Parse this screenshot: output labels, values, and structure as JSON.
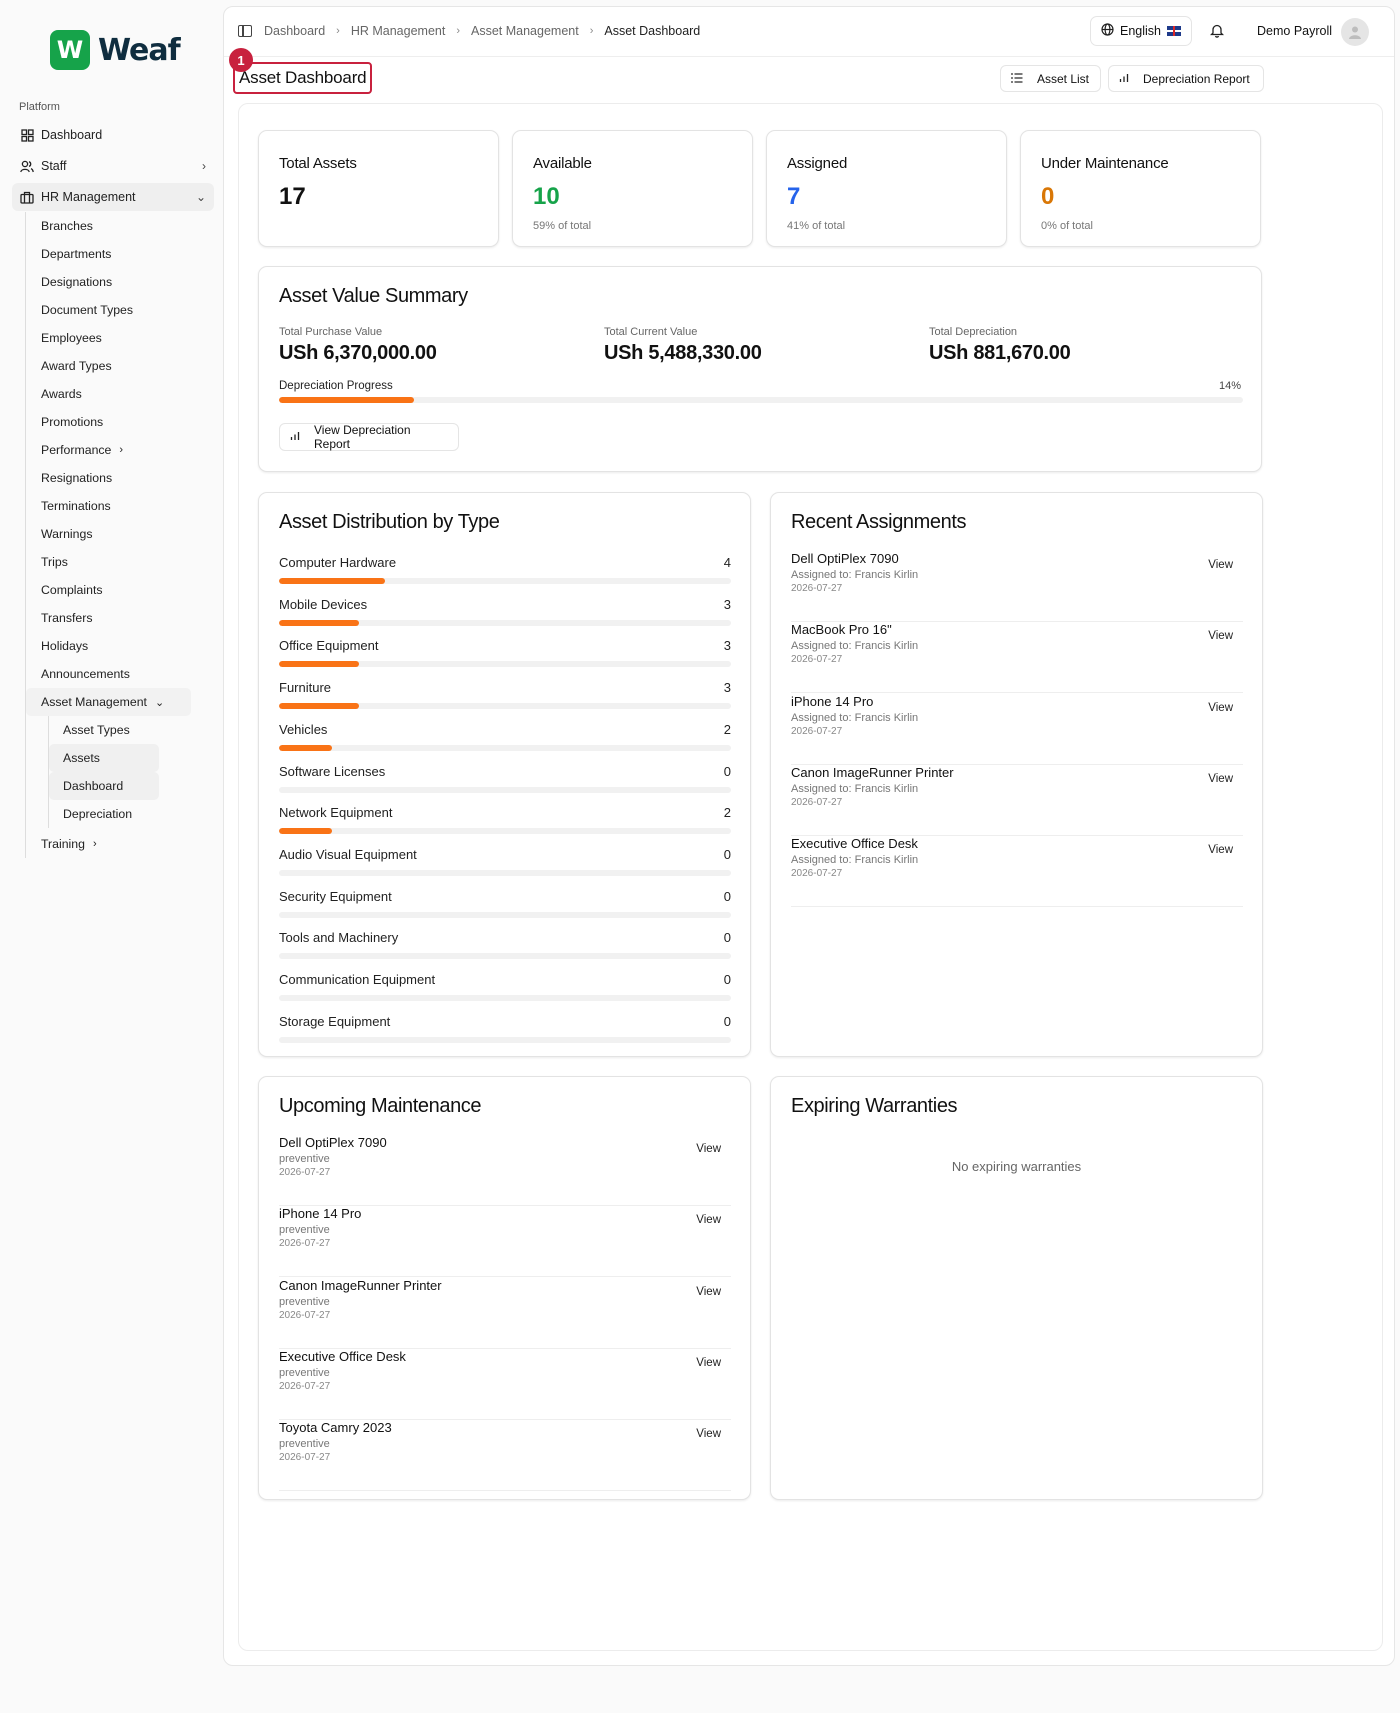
{
  "brand": {
    "logo_letter": "W",
    "name": "Weaf",
    "color": "#16a34a"
  },
  "sidebar": {
    "section_label": "Platform",
    "top_items": [
      {
        "label": "Dashboard",
        "icon": "grid-icon"
      },
      {
        "label": "Staff",
        "icon": "users-icon"
      },
      {
        "label": "HR Management",
        "icon": "briefcase-icon"
      }
    ],
    "hr_items": [
      "Branches",
      "Departments",
      "Designations",
      "Document Types",
      "Employees",
      "Award Types",
      "Awards",
      "Promotions",
      "Performance",
      "Resignations",
      "Terminations",
      "Warnings",
      "Trips",
      "Complaints",
      "Transfers",
      "Holidays",
      "Announcements",
      "Asset Management"
    ],
    "asset_items": [
      "Asset Types",
      "Assets",
      "Dashboard",
      "Depreciation"
    ],
    "training_label": "Training"
  },
  "topbar": {
    "breadcrumbs": [
      "Dashboard",
      "HR Management",
      "Asset Management",
      "Asset Dashboard"
    ],
    "language": "English",
    "user_name": "Demo Payroll"
  },
  "header": {
    "badge": "1",
    "title": "Asset Dashboard",
    "asset_list_label": "Asset List",
    "depreciation_report_label": "Depreciation Report"
  },
  "stats": [
    {
      "label": "Total Assets",
      "value": "17",
      "sub": "",
      "color": "#111111"
    },
    {
      "label": "Available",
      "value": "10",
      "sub": "59% of total",
      "color": "#16a34a"
    },
    {
      "label": "Assigned",
      "value": "7",
      "sub": "41% of total",
      "color": "#2563eb"
    },
    {
      "label": "Under Maintenance",
      "value": "0",
      "sub": "0% of total",
      "color": "#d97706"
    }
  ],
  "value_summary": {
    "title": "Asset Value Summary",
    "purchase_label": "Total Purchase Value",
    "purchase_value": "USh 6,370,000.00",
    "current_label": "Total Current Value",
    "current_value": "USh 5,488,330.00",
    "depreciation_label": "Total Depreciation",
    "depreciation_value": "USh 881,670.00",
    "progress_label": "Depreciation Progress",
    "progress_text": "14%",
    "progress_fraction": 0.14,
    "button_label": "View Depreciation Report"
  },
  "distribution": {
    "title": "Asset Distribution by Type",
    "max": 17,
    "items": [
      {
        "label": "Computer Hardware",
        "count": 4
      },
      {
        "label": "Mobile Devices",
        "count": 3
      },
      {
        "label": "Office Equipment",
        "count": 3
      },
      {
        "label": "Furniture",
        "count": 3
      },
      {
        "label": "Vehicles",
        "count": 2
      },
      {
        "label": "Software Licenses",
        "count": 0
      },
      {
        "label": "Network Equipment",
        "count": 2
      },
      {
        "label": "Audio Visual Equipment",
        "count": 0
      },
      {
        "label": "Security Equipment",
        "count": 0
      },
      {
        "label": "Tools and Machinery",
        "count": 0
      },
      {
        "label": "Communication Equipment",
        "count": 0
      },
      {
        "label": "Storage Equipment",
        "count": 0
      }
    ]
  },
  "recent_assignments": {
    "title": "Recent Assignments",
    "view_label": "View",
    "items": [
      {
        "name": "Dell OptiPlex 7090",
        "sub": "Assigned to: Francis Kirlin",
        "date": "2026-07-27"
      },
      {
        "name": "MacBook Pro 16\"",
        "sub": "Assigned to: Francis Kirlin",
        "date": "2026-07-27"
      },
      {
        "name": "iPhone 14 Pro",
        "sub": "Assigned to: Francis Kirlin",
        "date": "2026-07-27"
      },
      {
        "name": "Canon ImageRunner Printer",
        "sub": "Assigned to: Francis Kirlin",
        "date": "2026-07-27"
      },
      {
        "name": "Executive Office Desk",
        "sub": "Assigned to: Francis Kirlin",
        "date": "2026-07-27"
      }
    ]
  },
  "upcoming_maintenance": {
    "title": "Upcoming Maintenance",
    "view_label": "View",
    "items": [
      {
        "name": "Dell OptiPlex 7090",
        "sub": "preventive",
        "date": "2026-07-27"
      },
      {
        "name": "iPhone 14 Pro",
        "sub": "preventive",
        "date": "2026-07-27"
      },
      {
        "name": "Canon ImageRunner Printer",
        "sub": "preventive",
        "date": "2026-07-27"
      },
      {
        "name": "Executive Office Desk",
        "sub": "preventive",
        "date": "2026-07-27"
      },
      {
        "name": "Toyota Camry 2023",
        "sub": "preventive",
        "date": "2026-07-27"
      }
    ]
  },
  "expiring_warranties": {
    "title": "Expiring Warranties",
    "empty_text": "No expiring warranties"
  }
}
